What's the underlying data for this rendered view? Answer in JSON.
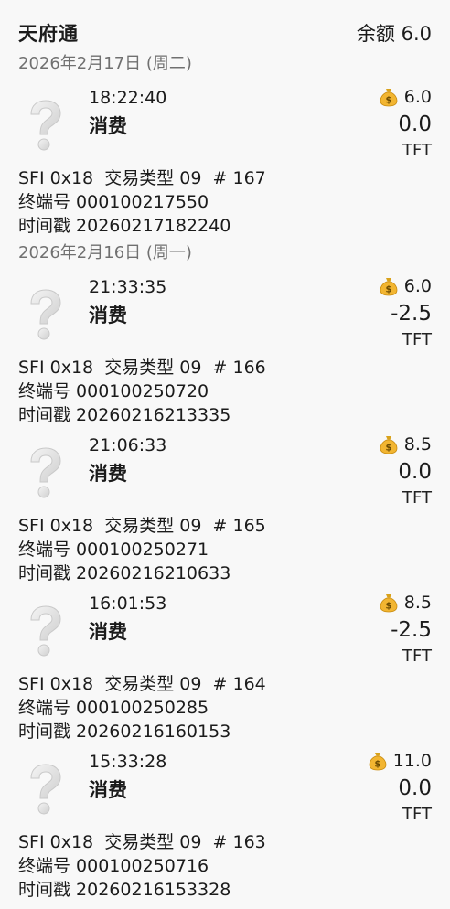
{
  "app": {
    "title": "天府通",
    "balance_label": "余额 6.0"
  },
  "groups": [
    {
      "date": "2026年2月17日 (周二)",
      "items": [
        {
          "time": "18:22:40",
          "type": "消费",
          "balance": "6.0",
          "amount": "0.0",
          "unit": "TFT",
          "line1": "SFI 0x18  交易类型 09  # 167",
          "line2": "终端号 000100217550",
          "line3": "时间戳 20260217182240"
        }
      ]
    },
    {
      "date": "2026年2月16日 (周一)",
      "items": [
        {
          "time": "21:33:35",
          "type": "消费",
          "balance": "6.0",
          "amount": "-2.5",
          "unit": "TFT",
          "line1": "SFI 0x18  交易类型 09  # 166",
          "line2": "终端号 000100250720",
          "line3": "时间戳 20260216213335"
        },
        {
          "time": "21:06:33",
          "type": "消费",
          "balance": "8.5",
          "amount": "0.0",
          "unit": "TFT",
          "line1": "SFI 0x18  交易类型 09  # 165",
          "line2": "终端号 000100250271",
          "line3": "时间戳 20260216210633"
        },
        {
          "time": "16:01:53",
          "type": "消费",
          "balance": "8.5",
          "amount": "-2.5",
          "unit": "TFT",
          "line1": "SFI 0x18  交易类型 09  # 164",
          "line2": "终端号 000100250285",
          "line3": "时间戳 20260216160153"
        },
        {
          "time": "15:33:28",
          "type": "消费",
          "balance": "11.0",
          "amount": "0.0",
          "unit": "TFT",
          "line1": "SFI 0x18  交易类型 09  # 163",
          "line2": "终端号 000100250716",
          "line3": "时间戳 20260216153328"
        }
      ]
    }
  ],
  "icons": {
    "transaction": "question-mark-icon",
    "balance": "money-bag-icon"
  }
}
